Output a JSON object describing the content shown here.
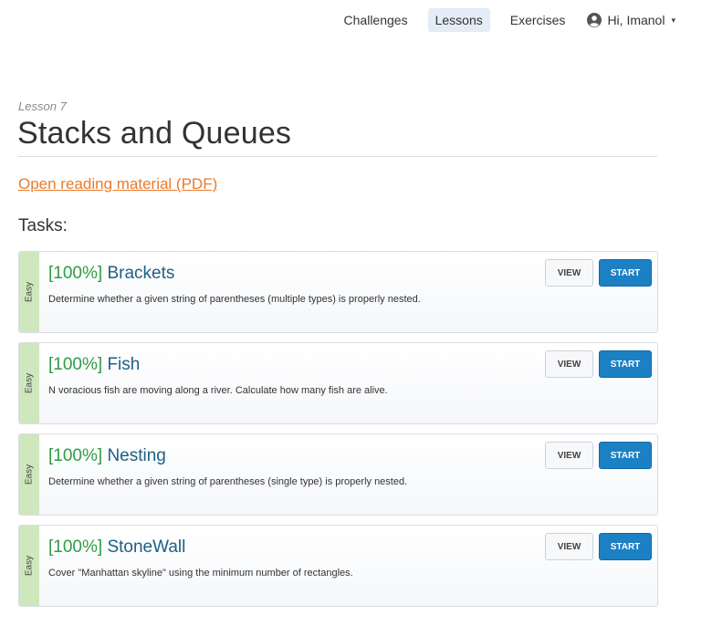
{
  "nav": {
    "links": [
      {
        "label": "Challenges",
        "active": false
      },
      {
        "label": "Lessons",
        "active": true
      },
      {
        "label": "Exercises",
        "active": false
      }
    ],
    "user_label": "Hi, Imanol",
    "caret": "▾"
  },
  "lesson": {
    "label": "Lesson 7",
    "title": "Stacks and Queues",
    "pdf_link": "Open reading material (PDF)",
    "tasks_heading": "Tasks:"
  },
  "buttons": {
    "view": "VIEW",
    "start": "START"
  },
  "tasks": [
    {
      "difficulty": "Easy",
      "score": "[100%]",
      "name": "Brackets",
      "description": "Determine whether a given string of parentheses (multiple types) is properly nested."
    },
    {
      "difficulty": "Easy",
      "score": "[100%]",
      "name": "Fish",
      "description": "N voracious fish are moving along a river. Calculate how many fish are alive."
    },
    {
      "difficulty": "Easy",
      "score": "[100%]",
      "name": "Nesting",
      "description": "Determine whether a given string of parentheses (single type) is properly nested."
    },
    {
      "difficulty": "Easy",
      "score": "[100%]",
      "name": "StoneWall",
      "description": "Cover \"Manhattan skyline\" using the minimum number of rectangles."
    }
  ],
  "colors": {
    "accent_blue": "#1b80c4",
    "score_green": "#2e9d45",
    "title_blue": "#1f5f84",
    "pdf_orange": "#e87c2b",
    "easy_strip": "#cfe7bd"
  }
}
